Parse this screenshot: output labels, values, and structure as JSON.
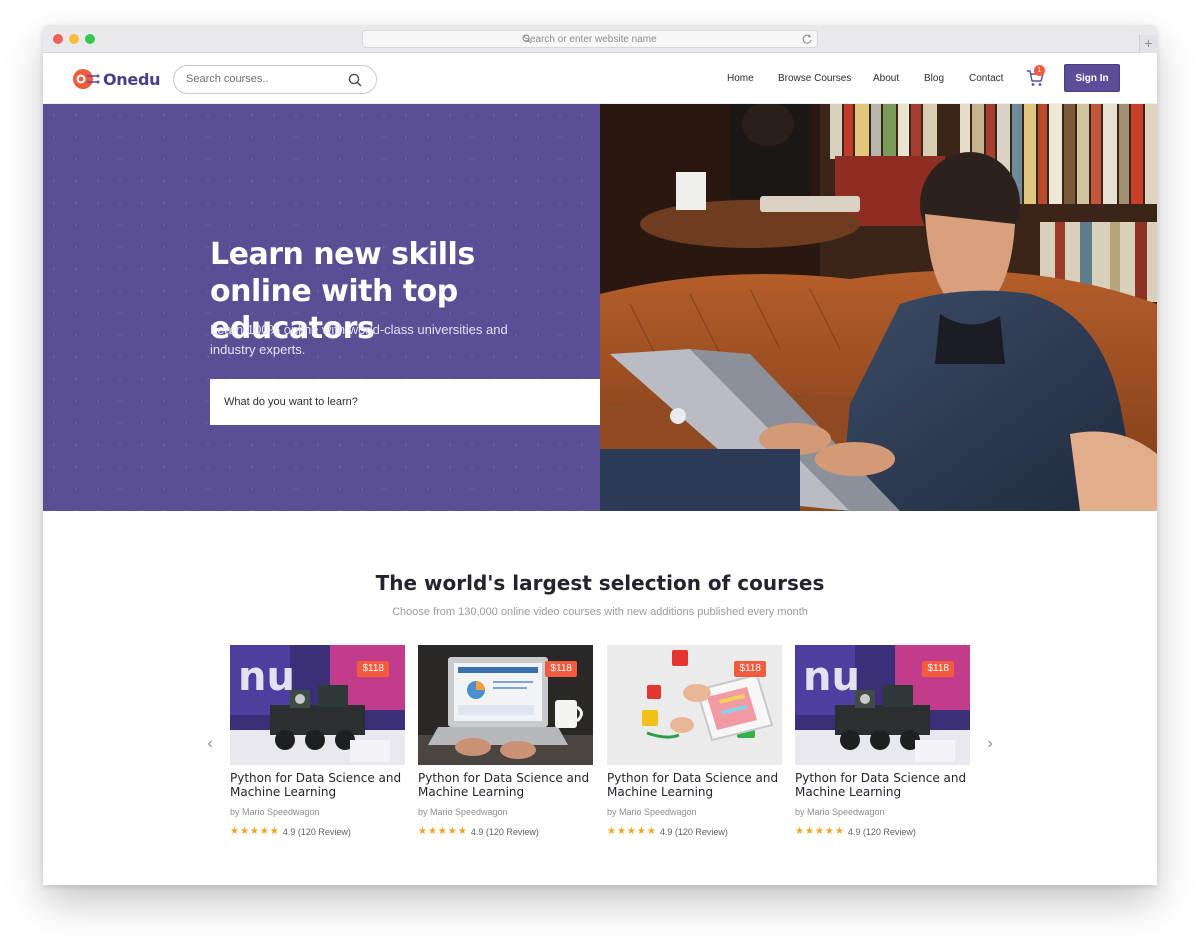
{
  "browser": {
    "url_placeholder": "Search or enter website name",
    "new_tab": "+"
  },
  "header": {
    "logo_text": "Onedu",
    "search_placeholder": "Search courses..",
    "nav": [
      "Home",
      "Browse Courses",
      "About",
      "Blog",
      "Contact"
    ],
    "cart_count": "1",
    "signin_label": "Sign In",
    "brand_color": "#5b4d98",
    "accent_color": "#f25b3d"
  },
  "hero": {
    "title": "Learn new skills online with top educators",
    "subtitle": "Learn 100% online with world-class universities and industry experts.",
    "search_placeholder": "What do you want to learn?",
    "background_color": "#5a4e94"
  },
  "courses_section": {
    "title": "The world's largest selection of courses",
    "subtitle": "Choose from 130,000 online video courses with new additions published every month",
    "prev_icon": "chevron-left-icon",
    "next_icon": "chevron-right-icon",
    "cards": [
      {
        "price": "$118",
        "title": "Python for Data Science and Machine Learning",
        "author": "by Mario Speedwagon",
        "rating": "4.9",
        "reviews": "(120 Review)",
        "image": "robot-kit"
      },
      {
        "price": "$118",
        "title": "Python for Data Science and Machine Learning",
        "author": "by Mario Speedwagon",
        "rating": "4.9",
        "reviews": "(120 Review)",
        "image": "laptop-analytics"
      },
      {
        "price": "$118",
        "title": "Python for Data Science and Machine Learning",
        "author": "by Mario Speedwagon",
        "rating": "4.9",
        "reviews": "(120 Review)",
        "image": "tablet-blocks"
      },
      {
        "price": "$118",
        "title": "Python for Data Science and Machine Learning",
        "author": "by Mario Speedwagon",
        "rating": "4.9",
        "reviews": "(120 Review)",
        "image": "robot-kit"
      }
    ]
  }
}
